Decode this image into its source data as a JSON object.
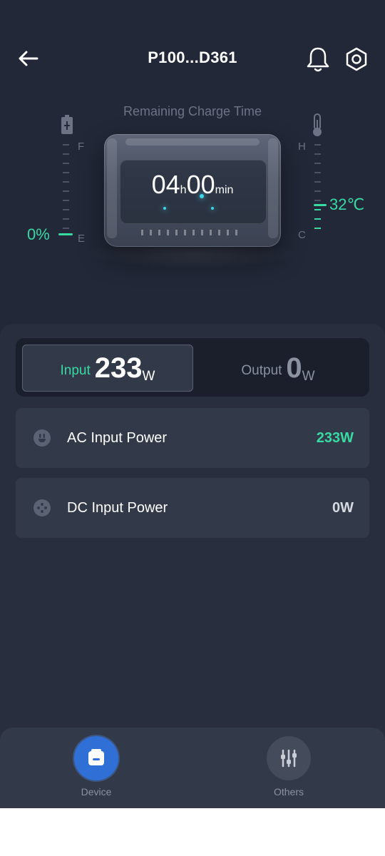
{
  "header": {
    "title": "P100...D361",
    "back_icon": "arrow-left-icon",
    "bell_icon": "bell-icon",
    "settings_icon": "hex-gear-icon"
  },
  "hero": {
    "remaining_label": "Remaining Charge Time",
    "timer": {
      "hours": "04",
      "hours_unit": "h",
      "minutes": "00",
      "minutes_unit": "min"
    },
    "battery": {
      "icon": "battery-icon",
      "value_text": "0%",
      "level_percent": 0,
      "top_label": "F",
      "bottom_label": "E"
    },
    "temperature": {
      "icon": "thermometer-icon",
      "value_text": "32℃",
      "top_label": "H",
      "bottom_label": "C"
    }
  },
  "tabs": {
    "input": {
      "label": "Input",
      "value": "233",
      "unit": "W",
      "selected": true
    },
    "output": {
      "label": "Output",
      "value": "0",
      "unit": "W",
      "selected": false
    }
  },
  "rows": {
    "ac": {
      "icon": "ac-plug-icon",
      "label": "AC Input Power",
      "value": "233W"
    },
    "dc": {
      "icon": "dc-plug-icon",
      "label": "DC Input Power",
      "value": "0W"
    }
  },
  "nav": {
    "device": {
      "label": "Device",
      "icon": "device-icon"
    },
    "others": {
      "label": "Others",
      "icon": "sliders-icon"
    }
  },
  "colors": {
    "accent_green": "#39d9a4",
    "accent_blue": "#2f6fd6",
    "background": "#222838",
    "panel": "#282e3e",
    "card": "#323948"
  }
}
